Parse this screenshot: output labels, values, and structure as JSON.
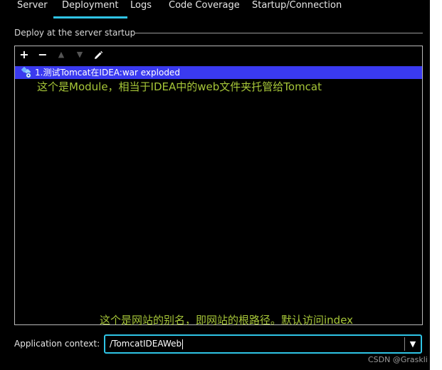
{
  "tabs": [
    {
      "label": "Server"
    },
    {
      "label": "Deployment",
      "active": true
    },
    {
      "label": "Logs"
    },
    {
      "label": "Code Coverage"
    },
    {
      "label": "Startup/Connection"
    }
  ],
  "deploy": {
    "section_title": "Deploy at the server startup",
    "toolbar": {
      "add_icon": "plus-icon",
      "remove_icon": "minus-icon",
      "up_icon": "arrow-up-icon",
      "down_icon": "arrow-down-icon",
      "edit_icon": "pencil-icon"
    },
    "items": [
      {
        "label": "1.测试Tomcat在IDEA:war exploded",
        "icon": "artifact-icon",
        "selected": true
      }
    ]
  },
  "annotations": {
    "module_note": "这个是Module，相当于IDEA中的web文件夹托管给Tomcat",
    "context_note": "这个是网站的别名，即网站的根路径。默认访问index"
  },
  "app_context": {
    "label": "Application context:",
    "value": "/TomcatIDEAWeb"
  },
  "watermark": "CSDN @Graskli",
  "colors": {
    "accent": "#2fc4e6",
    "selection": "#3a3af0",
    "annotation": "#a6c638"
  }
}
